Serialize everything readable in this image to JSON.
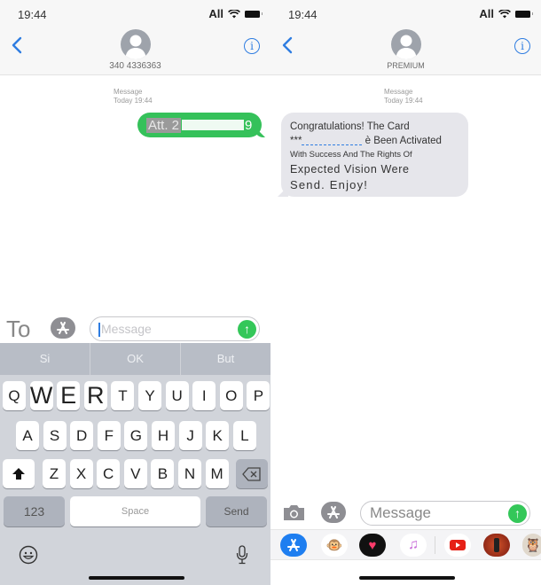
{
  "left": {
    "status": {
      "time": "19:44",
      "carrier": "All"
    },
    "contact": {
      "name": "340 4336363"
    },
    "thread": {
      "meta_label": "Message",
      "meta_time": "Today 19:44",
      "outgoing_message": {
        "visible_prefix": "Att. 2",
        "visible_suffix": "9"
      }
    },
    "composer": {
      "apps_label": "To",
      "placeholder": "Message"
    },
    "keyboard": {
      "suggestions": [
        "Si",
        "OK",
        "But"
      ],
      "row1": [
        "Q",
        "W",
        "E",
        "R",
        "T",
        "Y",
        "U",
        "I",
        "O",
        "P"
      ],
      "row2": [
        "A",
        "S",
        "D",
        "F",
        "G",
        "H",
        "J",
        "K",
        "L"
      ],
      "row3": [
        "Z",
        "X",
        "C",
        "V",
        "B",
        "N",
        "M"
      ],
      "numbers_label": "123",
      "space_label": "Space",
      "send_label": "Send"
    }
  },
  "right": {
    "status": {
      "time": "19:44",
      "carrier": "All"
    },
    "contact": {
      "name": "PREMIUM"
    },
    "thread": {
      "meta_label": "Message",
      "meta_time": "Today 19:44",
      "incoming_message": {
        "line1": "Congratulations! The Card",
        "line2_prefix": "***",
        "line2_suffix": " è Been Activated",
        "line3": "With Success And The Rights Of",
        "line4": "Expected Vision Were",
        "line5": "Send. Enjoy!"
      }
    },
    "composer": {
      "placeholder": "Message"
    },
    "app_strip": [
      "App Store",
      "Animoji",
      "Digital Touch",
      "Music",
      "YouTube",
      "Game",
      "Sticker"
    ]
  },
  "colors": {
    "ios_blue": "#2f7de1",
    "imessage_green": "#35c15a",
    "incoming_gray": "#e6e6eb",
    "keyboard_bg": "#d1d4da"
  }
}
